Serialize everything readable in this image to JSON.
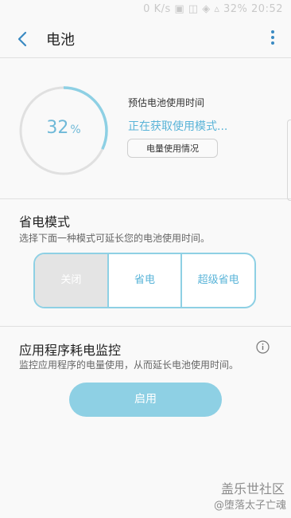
{
  "status_bar": {
    "text": "0 K/s ▣ ◫ ◈ ▵ 32% 20:52"
  },
  "app_bar": {
    "title": "电池"
  },
  "battery": {
    "percent": 32,
    "percent_number": "32",
    "percent_sign": "%",
    "estimate_label": "预估电池使用时间",
    "estimate_status": "正在获取使用模式...",
    "usage_button": "电量使用情况"
  },
  "power_saving": {
    "title": "省电模式",
    "description": "选择下面一种模式可延长您的电池使用时间。",
    "modes": [
      "关闭",
      "省电",
      "超级省电"
    ],
    "selected": "关闭"
  },
  "app_monitor": {
    "title": "应用程序耗电监控",
    "description": "监控应用程序的电量使用，从而延长电池使用时间。",
    "enable_button": "启用"
  },
  "watermark": {
    "logo": "盖乐世社区",
    "user": "@堕落太子亡魂"
  },
  "colors": {
    "accent": "#5ab4d8",
    "ring": "#8ed0e4",
    "track": "#e0e0e0"
  }
}
